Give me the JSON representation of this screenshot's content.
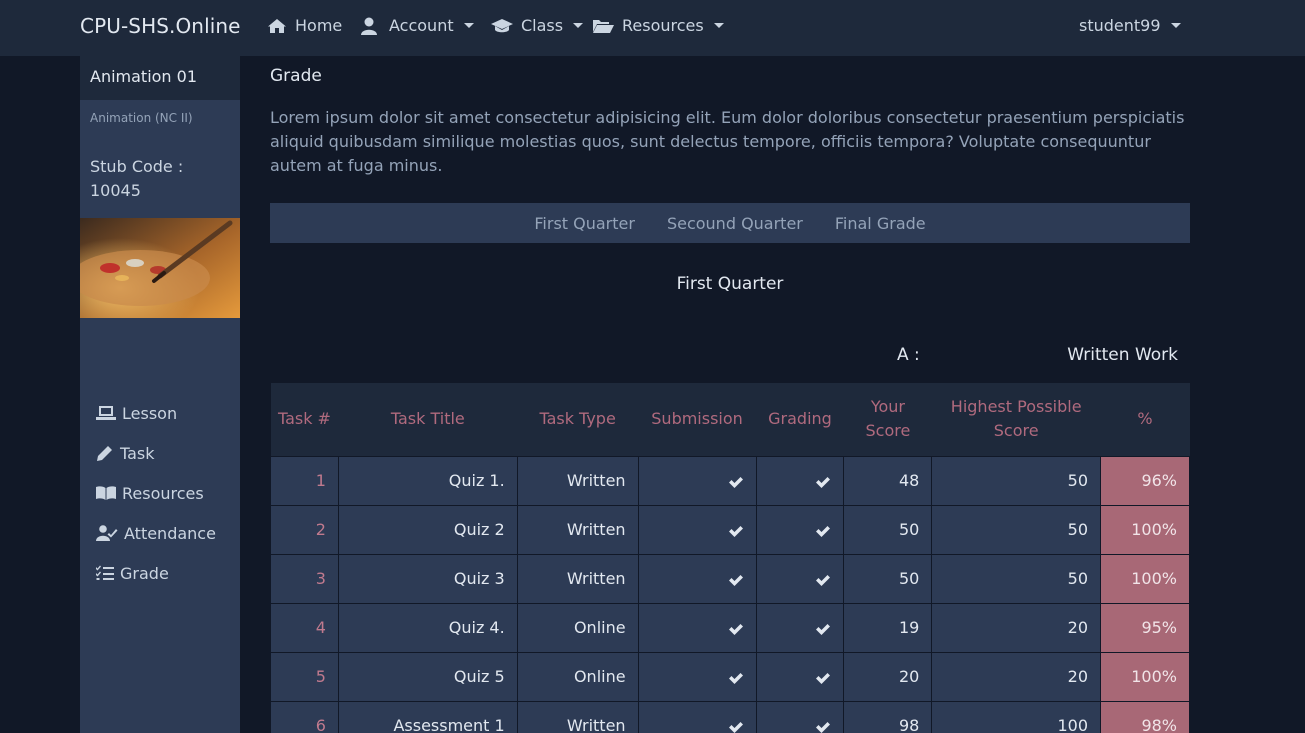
{
  "navbar": {
    "brand": "CPU-SHS.Online",
    "items": [
      {
        "label": "Home",
        "icon": "home-icon"
      },
      {
        "label": "Account",
        "icon": "user-icon"
      },
      {
        "label": "Class",
        "icon": "graduation-cap-icon"
      },
      {
        "label": "Resources",
        "icon": "folder-open-icon"
      }
    ],
    "user": "student99"
  },
  "sidebar": {
    "title": "Animation 01",
    "subtitle": "Animation (NC II)",
    "stub_code": "Stub Code : 10045",
    "menu": [
      {
        "label": "Lesson",
        "icon": "laptop-icon"
      },
      {
        "label": "Task",
        "icon": "pencil-icon"
      },
      {
        "label": "Resources",
        "icon": "book-icon"
      },
      {
        "label": "Attendance",
        "icon": "user-check-icon"
      },
      {
        "label": "Grade",
        "icon": "list-check-icon"
      }
    ]
  },
  "main": {
    "title": "Grade",
    "description": "Lorem ipsum dolor sit amet consectetur adipisicing elit. Eum dolor doloribus consectetur praesentium perspiciatis aliquid quibusdam similique molestias quos, sunt delectus tempore, officiis tempora? Voluptate consequuntur autem at fuga minus.",
    "tabs": [
      "First Quarter",
      "Secound Quarter",
      "Final Grade"
    ],
    "quarter_title": "First Quarter",
    "section_letter": "A :",
    "section_name": "Written Work",
    "table": {
      "headers": [
        "Task #",
        "Task Title",
        "Task Type",
        "Submission",
        "Grading",
        "Your Score",
        "Highest Possible Score",
        "%"
      ],
      "rows": [
        {
          "num": "1",
          "title": "Quiz 1.",
          "type": "Written",
          "score": "48",
          "highest": "50",
          "pct": "96%"
        },
        {
          "num": "2",
          "title": "Quiz 2",
          "type": "Written",
          "score": "50",
          "highest": "50",
          "pct": "100%"
        },
        {
          "num": "3",
          "title": "Quiz 3",
          "type": "Written",
          "score": "50",
          "highest": "50",
          "pct": "100%"
        },
        {
          "num": "4",
          "title": "Quiz 4.",
          "type": "Online",
          "score": "19",
          "highest": "20",
          "pct": "95%"
        },
        {
          "num": "5",
          "title": "Quiz 5",
          "type": "Online",
          "score": "20",
          "highest": "20",
          "pct": "100%"
        },
        {
          "num": "6",
          "title": "Assessment 1",
          "type": "Written",
          "score": "98",
          "highest": "100",
          "pct": "98%"
        }
      ]
    }
  },
  "colors": {
    "background": "#111827",
    "navbar": "#1e293b",
    "panel": "#2d3b55",
    "accent_text": "#b06a7e",
    "percent_cell": "#a86876"
  }
}
